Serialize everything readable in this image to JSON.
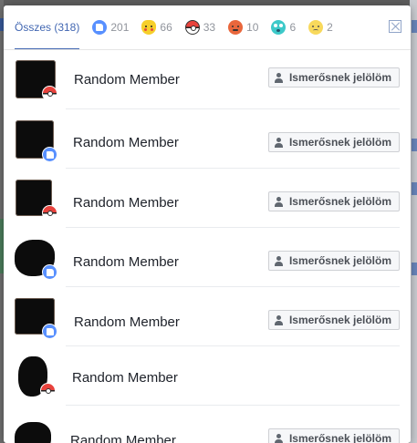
{
  "tabs": [
    {
      "id": "all",
      "label": "Összes (318)",
      "icon": null
    },
    {
      "id": "like",
      "count": "201",
      "icon": "like-icon"
    },
    {
      "id": "pikachu",
      "count": "66",
      "icon": "pikachu-icon"
    },
    {
      "id": "pokeball",
      "count": "33",
      "icon": "pokeball-icon"
    },
    {
      "id": "angry",
      "count": "10",
      "icon": "angry-icon"
    },
    {
      "id": "wow",
      "count": "6",
      "icon": "wow-icon"
    },
    {
      "id": "sad",
      "count": "2",
      "icon": "sad-icon"
    }
  ],
  "close_icon": "close-icon",
  "rows": [
    {
      "name": "Random Member",
      "reaction": "pokeball-icon",
      "button": "Ismerősnek jelölöm"
    },
    {
      "name": "Random Member",
      "reaction": "like-icon",
      "button": "Ismerősnek jelölöm"
    },
    {
      "name": "Random Member",
      "reaction": "pokeball-icon",
      "button": "Ismerősnek jelölöm"
    },
    {
      "name": "Random Member",
      "reaction": "like-icon",
      "button": "Ismerősnek jelölöm"
    },
    {
      "name": "Random Member",
      "reaction": "like-icon",
      "button": "Ismerősnek jelölöm"
    },
    {
      "name": "Random Member",
      "reaction": "pokeball-icon",
      "button": null
    },
    {
      "name": "Random Member",
      "reaction": null,
      "button": "Ismerősnek jelölöm"
    }
  ],
  "colors": {
    "accent": "#4267b2",
    "like": "#5890ff"
  }
}
